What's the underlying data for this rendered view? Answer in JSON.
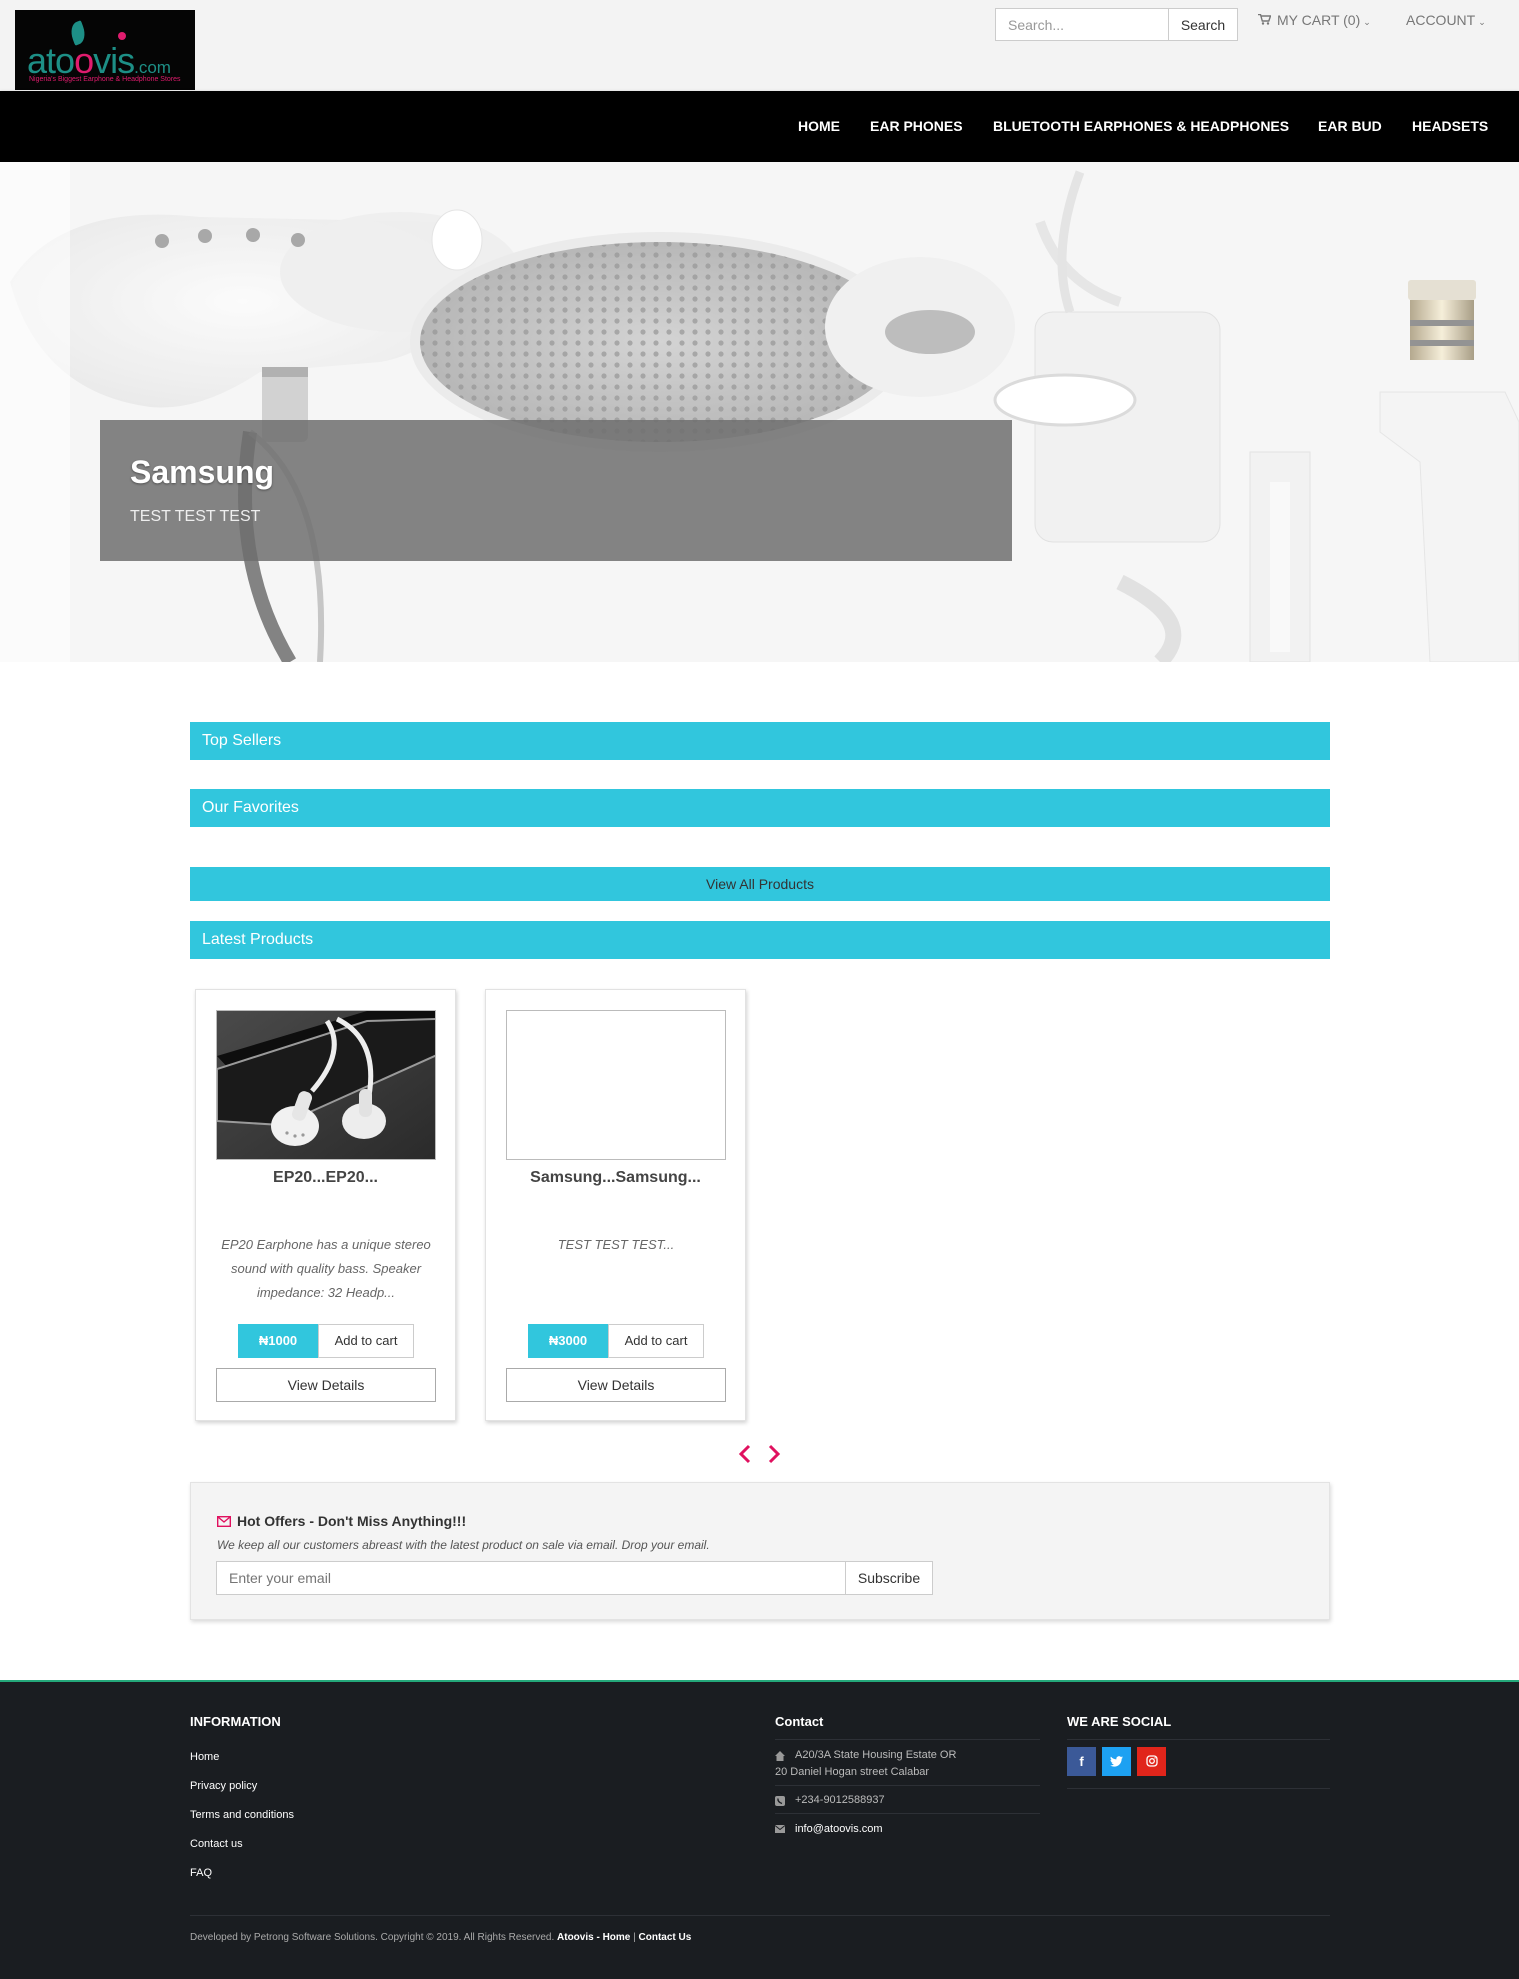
{
  "brand": {
    "name": "atoovis",
    "domain": ".com",
    "tagline": "Nigeria's Biggest Earphone & Headphone Stores"
  },
  "header": {
    "search_placeholder": "Search...",
    "search_button": "Search",
    "cart_label": "MY CART (0)",
    "account_label": "ACCOUNT"
  },
  "nav": {
    "items": [
      {
        "label": "HOME"
      },
      {
        "label": "EAR PHONES"
      },
      {
        "label": "BLUETOOTH EARPHONES & HEADPHONES"
      },
      {
        "label": "EAR BUD"
      },
      {
        "label": "HEADSETS"
      }
    ]
  },
  "hero": {
    "title": "Samsung",
    "subtitle": "TEST TEST TEST"
  },
  "sections": {
    "top_sellers": "Top Sellers",
    "our_favorites": "Our Favorites",
    "view_all": "View All Products",
    "latest_products": "Latest Products"
  },
  "products": [
    {
      "name": "EP20...EP20...",
      "description": "EP20 Earphone has a unique stereo sound with quality bass. Speaker impedance: 32 Headp...",
      "price": "₦1000",
      "add_to_cart": "Add to cart",
      "view_details": "View Details"
    },
    {
      "name": "Samsung...Samsung...",
      "description": "TEST TEST TEST...",
      "price": "₦3000",
      "add_to_cart": "Add to cart",
      "view_details": "View Details"
    }
  ],
  "newsletter": {
    "title": "Hot Offers - Don't Miss Anything!!!",
    "text": "We keep all our customers abreast with the latest product on sale via email. Drop your email.",
    "placeholder": "Enter your email",
    "button": "Subscribe"
  },
  "footer": {
    "info_heading": "INFORMATION",
    "links": [
      "Home",
      "Privacy policy",
      "Terms and conditions",
      "Contact us",
      "FAQ"
    ],
    "contact_heading": "Contact",
    "address_line1": "A20/3A State Housing Estate OR",
    "address_line2": "20 Daniel Hogan street Calabar",
    "phone": "+234-9012588937",
    "email": "info@atoovis.com",
    "social_heading": "WE ARE SOCIAL",
    "social": [
      {
        "icon": "facebook-icon",
        "glyph": "f",
        "color": "#3b5998"
      },
      {
        "icon": "twitter-icon",
        "glyph": "t",
        "color": "#1da1f2"
      },
      {
        "icon": "instagram-icon",
        "glyph": "◎",
        "color": "#e1251b"
      }
    ],
    "copyright_text": "Developed by Petrong Software Solutions. Copyright © 2019. All Rights Reserved.",
    "copyright_link1": "Atoovis - Home",
    "copyright_sep": "|",
    "copyright_link2": "Contact Us"
  },
  "colors": {
    "accent": "#31c6dd",
    "brand_teal": "#1d8f86",
    "brand_pink": "#e01c6e",
    "nav_bg": "#000000",
    "footer_bg": "#1a1d21",
    "arrow": "#e0115f"
  }
}
